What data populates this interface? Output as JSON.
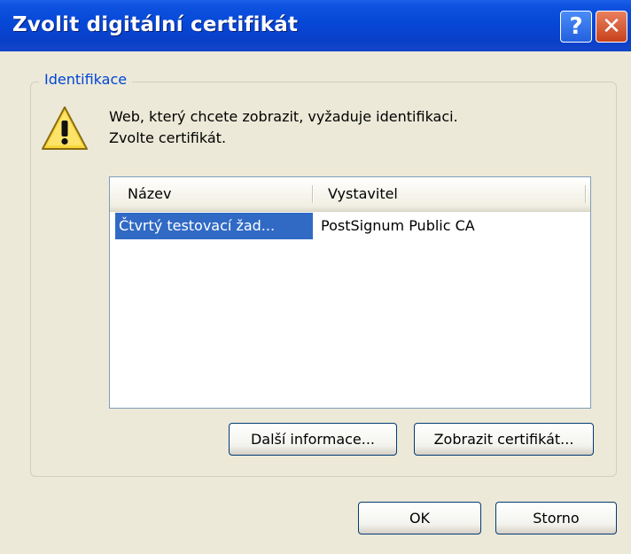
{
  "window": {
    "title": "Zvolit digitální certifikát",
    "help_glyph": "?",
    "close_glyph": "✕"
  },
  "group": {
    "legend": "Identifikace"
  },
  "message": {
    "line1": "Web, který chcete zobrazit, vyžaduje identifikaci.",
    "line2": "Zvolte certifikát.",
    "icon": "warning-icon"
  },
  "certificate_list": {
    "columns": [
      "Název",
      "Vystavitel"
    ],
    "rows": [
      {
        "name": "Čtvrtý testovací žad...",
        "issuer": "PostSignum Public CA",
        "selected": true
      }
    ]
  },
  "buttons": {
    "more_info": "Další informace...",
    "view_certificate": "Zobrazit certifikát...",
    "ok": "OK",
    "cancel": "Storno"
  },
  "colors": {
    "titlebar": "#0a46d6",
    "dialog_bg": "#ece9d8",
    "selection": "#316ac5",
    "legend_text": "#0046d5"
  }
}
